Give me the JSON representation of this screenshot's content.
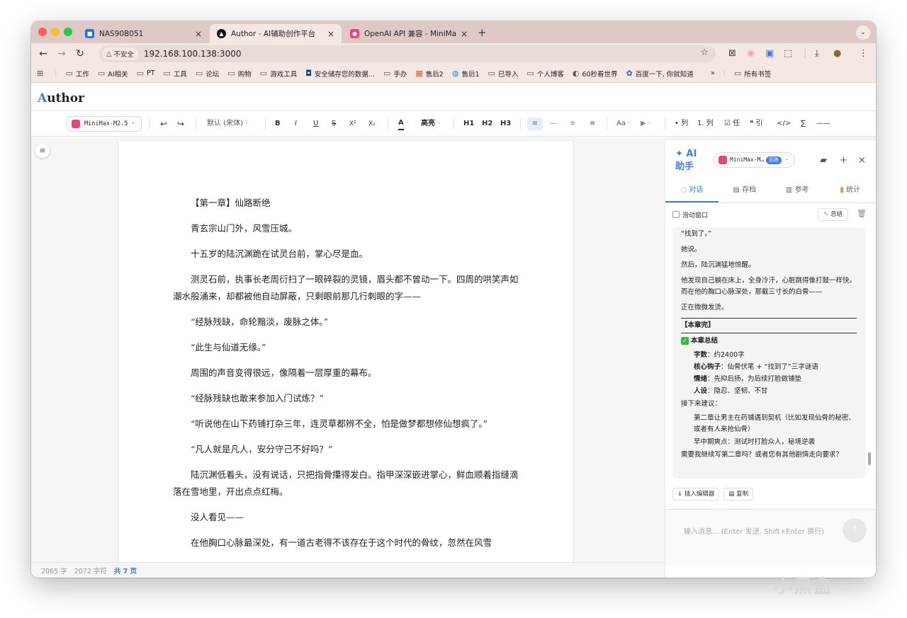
{
  "browser": {
    "tabs": [
      {
        "title": "NAS90B051",
        "icon": "nas-icon"
      },
      {
        "title": "Author - AI辅助创作平台",
        "icon": "author-icon"
      },
      {
        "title": "OpenAI API 兼容 - MiniMax 开",
        "icon": "minimax-icon"
      }
    ],
    "not_secure_label": "不安全",
    "url": "192.168.100.138:3000",
    "bookmarks": [
      {
        "label": "工作",
        "icon": "folder-icon"
      },
      {
        "label": "AI相关",
        "icon": "folder-icon"
      },
      {
        "label": "PT",
        "icon": "folder-icon"
      },
      {
        "label": "工具",
        "icon": "folder-icon"
      },
      {
        "label": "论坛",
        "icon": "folder-icon"
      },
      {
        "label": "购物",
        "icon": "folder-icon"
      },
      {
        "label": "游戏工具",
        "icon": "folder-icon"
      },
      {
        "label": "安全储存您的数据...",
        "icon": "vault-icon"
      },
      {
        "label": "手办",
        "icon": "folder-icon"
      },
      {
        "label": "售后2",
        "icon": "windows-icon"
      },
      {
        "label": "售后1",
        "icon": "globe-icon"
      },
      {
        "label": "已导入",
        "icon": "folder-icon"
      },
      {
        "label": "个人博客",
        "icon": "folder-icon"
      },
      {
        "label": "60秒看世界",
        "icon": "news-icon"
      },
      {
        "label": "百度一下, 你就知道",
        "icon": "baidu-icon"
      }
    ],
    "more_bookmarks": "»",
    "all_bookmarks": "所有书签"
  },
  "app": {
    "logo_first": "A",
    "logo_rest": "uthor",
    "model_name": "MiniMax-M2.5",
    "toolbar": {
      "font": "默认 (宋体)",
      "bold": "B",
      "italic": "I",
      "underline": "U",
      "strike": "S",
      "superscript": "X²",
      "subscript": "X₂",
      "color": "A",
      "highlight": "高亮",
      "h1": "H1",
      "h2": "H2",
      "h3": "H3",
      "font_size": "Aa",
      "bullet_list": "• 列",
      "ordered_list": "1. 列",
      "task_list": "☑ 任",
      "quote": "❝ 引",
      "code": "</>",
      "math": "∑",
      "divider": "——"
    },
    "document": {
      "paragraphs": [
        "【第一章】仙路断绝",
        "青玄宗山门外，风雪压城。",
        "十五岁的陆沉渊跪在试灵台前，掌心尽是血。",
        "测灵石前，执事长老周衍扫了一眼碎裂的灵镜，眉头都不曾动一下。四周的哄笑声如潮水般涌来，却都被他自动屏蔽，只剩眼前那几行刺眼的字——",
        "“经脉残缺，命轮黯淡，废脉之体。”",
        "“此生与仙道无缘。”",
        "周围的声音变得很远，像隔着一层厚重的幕布。",
        "“经脉残缺也敢来参加入门试炼？”",
        "“听说他在山下药铺打杂三年，连灵草都辨不全，怕是做梦都想修仙想疯了。”",
        "“凡人就是凡人，安分守己不好吗？”",
        "陆沉渊低着头，没有说话，只把指骨攥得发白。指甲深深嵌进掌心，鲜血顺着指缝滴落在雪地里，开出点点红梅。",
        "没人看见——",
        "在他胸口心脉最深处，有一道古老得不该存在于这个时代的骨纹，忽然在风雪"
      ]
    },
    "status": {
      "words": "2065 字",
      "chars": "2072 字符",
      "pages": "共 7 页"
    },
    "ai": {
      "title": "✦ AI 助手",
      "model": "MiniMax-M…",
      "model_badge": "回答",
      "tabs": [
        "对话",
        "存档",
        "参考",
        "统计"
      ],
      "scroll_window": "滑动窗口",
      "summarize": "总结",
      "messages": {
        "l1": "“找到了。”",
        "l2": "她说。",
        "l3": "然后，陆沉渊猛地惊醒。",
        "l4": "他发现自己躺在床上，全身冷汗，心脏跳得像打鼓一样快。而在他的胸口心脉深处，那截三寸长的白骨——",
        "l5": "正在微微发烫。",
        "end": "【本章完】",
        "summary_title": "本章总结",
        "s1_key": "字数",
        "s1_val": "：约2400字",
        "s2_key": "核心钩子",
        "s2_val": "：仙骨伏笔 + “找到了”三字谜语",
        "s3_key": "情绪",
        "s3_val": "：先抑后扬，为后续打脸做铺垫",
        "s4_key": "人设",
        "s4_val": "：隐忍、坚韧、不甘",
        "next_title": "接下来建议：",
        "n1": "第二章让男主在药铺遇到契机（比如发现仙骨的秘密、或者有人来抢仙骨）",
        "n2": "早中期爽点：测试时打脸众人，秘境逆袭",
        "question": "需要我继续写第二章吗？或者您有其他剧情走向要求？"
      },
      "insert_btn": "↓ 插入编辑器",
      "copy_btn": "复制",
      "input_placeholder": "输入消息... (Enter 发送, Shift+Enter 换行)"
    }
  },
  "watermark": "小黑盒",
  "colors": {
    "accent": "#3d7be8",
    "tab_strip": "#dfc9c4",
    "model_icon": "#e8457a"
  }
}
